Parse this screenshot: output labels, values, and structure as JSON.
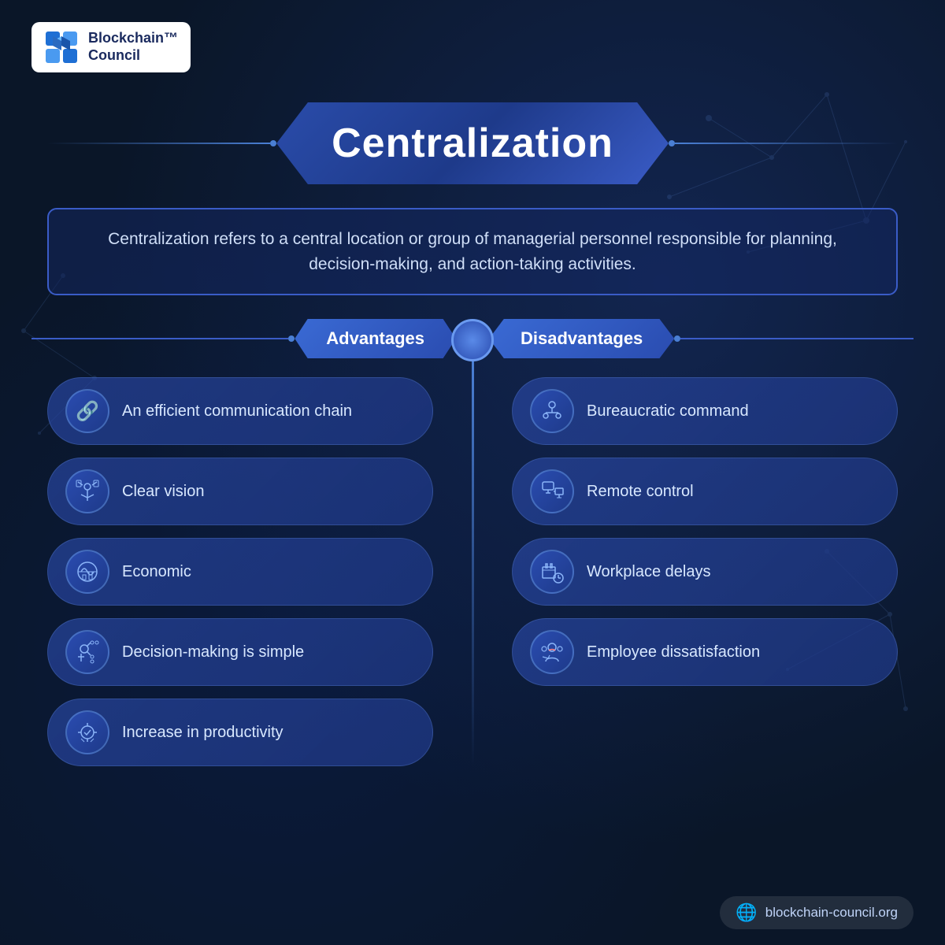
{
  "brand": {
    "name_line1": "Blockchain™",
    "name_line2": "Council"
  },
  "title": "Centralization",
  "description": "Centralization refers to a central location or group of managerial personnel responsible for planning, decision-making, and action-taking activities.",
  "advantages": {
    "header": "Advantages",
    "items": [
      {
        "text": "An efficient communication chain",
        "icon": "🔗"
      },
      {
        "text": "Clear vision",
        "icon": "👐"
      },
      {
        "text": "Economic",
        "icon": "🌐"
      },
      {
        "text": "Decision-making is simple",
        "icon": "🔄"
      },
      {
        "text": "Increase in productivity",
        "icon": "⚙️"
      }
    ]
  },
  "disadvantages": {
    "header": "Disadvantages",
    "items": [
      {
        "text": "Bureaucratic command",
        "icon": "👥"
      },
      {
        "text": "Remote control",
        "icon": "🖥️"
      },
      {
        "text": "Workplace delays",
        "icon": "⏰"
      },
      {
        "text": "Employee dissatisfaction",
        "icon": "😕"
      }
    ]
  },
  "footer": {
    "url": "blockchain-council.org"
  }
}
